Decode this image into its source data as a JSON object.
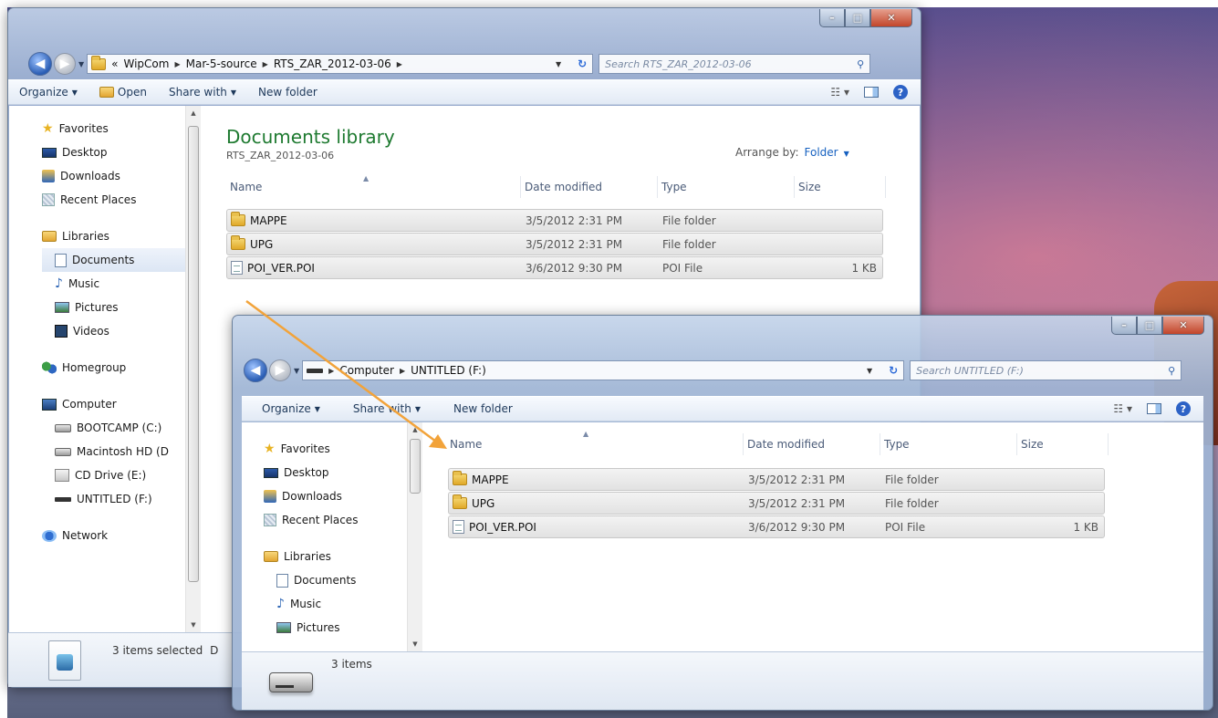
{
  "colors": {
    "accent": "#1560c0",
    "library_title": "#1e7a30",
    "drag_arrow": "#f2a33a"
  },
  "caption_glyphs": {
    "minimize": "–",
    "maximize": "□",
    "close": "✕"
  },
  "back_window": {
    "address": [
      "WipCom",
      "Mar-5-source",
      "RTS_ZAR_2012-03-06"
    ],
    "address_prefix": "«",
    "search_placeholder": "Search RTS_ZAR_2012-03-06",
    "toolbar": {
      "organize": "Organize",
      "open": "Open",
      "share_with": "Share with",
      "new_folder": "New folder"
    },
    "nav": {
      "favorites": "Favorites",
      "desktop": "Desktop",
      "downloads": "Downloads",
      "recent_places": "Recent Places",
      "libraries": "Libraries",
      "documents": "Documents",
      "music": "Music",
      "pictures": "Pictures",
      "videos": "Videos",
      "homegroup": "Homegroup",
      "computer": "Computer",
      "bootcamp": "BOOTCAMP (C:)",
      "macintosh": "Macintosh HD (D",
      "cd_drive": "CD Drive (E:)",
      "untitled": "UNTITLED (F:)",
      "network": "Network"
    },
    "library_title": "Documents library",
    "library_subtitle": "RTS_ZAR_2012-03-06",
    "arrange_by_label": "Arrange by:",
    "arrange_by_value": "Folder",
    "columns": {
      "name": "Name",
      "date_modified": "Date modified",
      "type": "Type",
      "size": "Size"
    },
    "files": [
      {
        "name": "MAPPE",
        "date": "3/5/2012 2:31 PM",
        "type": "File folder",
        "size": ""
      },
      {
        "name": "UPG",
        "date": "3/5/2012 2:31 PM",
        "type": "File folder",
        "size": ""
      },
      {
        "name": "POI_VER.POI",
        "date": "3/6/2012 9:30 PM",
        "type": "POI File",
        "size": "1 KB"
      }
    ],
    "status_text": "3 items selected",
    "status_text_extra": "D"
  },
  "front_window": {
    "address": [
      "Computer",
      "UNTITLED (F:)"
    ],
    "search_placeholder": "Search UNTITLED (F:)",
    "toolbar": {
      "organize": "Organize",
      "share_with": "Share with",
      "new_folder": "New folder"
    },
    "nav": {
      "favorites": "Favorites",
      "desktop": "Desktop",
      "downloads": "Downloads",
      "recent_places": "Recent Places",
      "libraries": "Libraries",
      "documents": "Documents",
      "music": "Music",
      "pictures": "Pictures"
    },
    "columns": {
      "name": "Name",
      "date_modified": "Date modified",
      "type": "Type",
      "size": "Size"
    },
    "files": [
      {
        "name": "MAPPE",
        "date": "3/5/2012 2:31 PM",
        "type": "File folder",
        "size": ""
      },
      {
        "name": "UPG",
        "date": "3/5/2012 2:31 PM",
        "type": "File folder",
        "size": ""
      },
      {
        "name": "POI_VER.POI",
        "date": "3/6/2012 9:30 PM",
        "type": "POI File",
        "size": "1 KB"
      }
    ],
    "status_text": "3 items"
  }
}
